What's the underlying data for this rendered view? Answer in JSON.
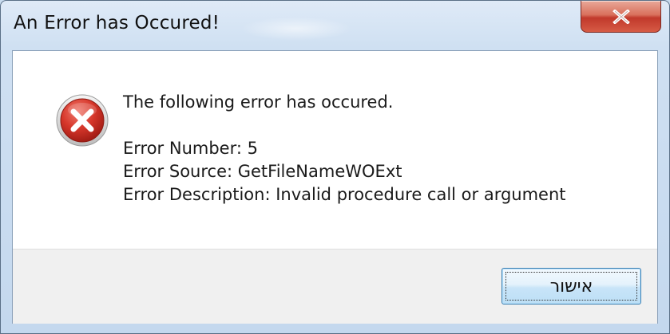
{
  "window": {
    "title": "An Error has Occured!",
    "close_icon": "close-x-icon"
  },
  "message": {
    "header": "The following error has occured.",
    "error_number": "Error Number: 5",
    "error_source": "Error Source: GetFileNameWOExt",
    "error_description": "Error Description: Invalid procedure call or argument",
    "icon": "error-icon"
  },
  "buttons": {
    "ok_label": "אישור"
  },
  "colors": {
    "close_button": "#c1392b",
    "error_icon": "#c62828",
    "button_area": "#f0f0f0",
    "frame": "#c4d8ee"
  }
}
